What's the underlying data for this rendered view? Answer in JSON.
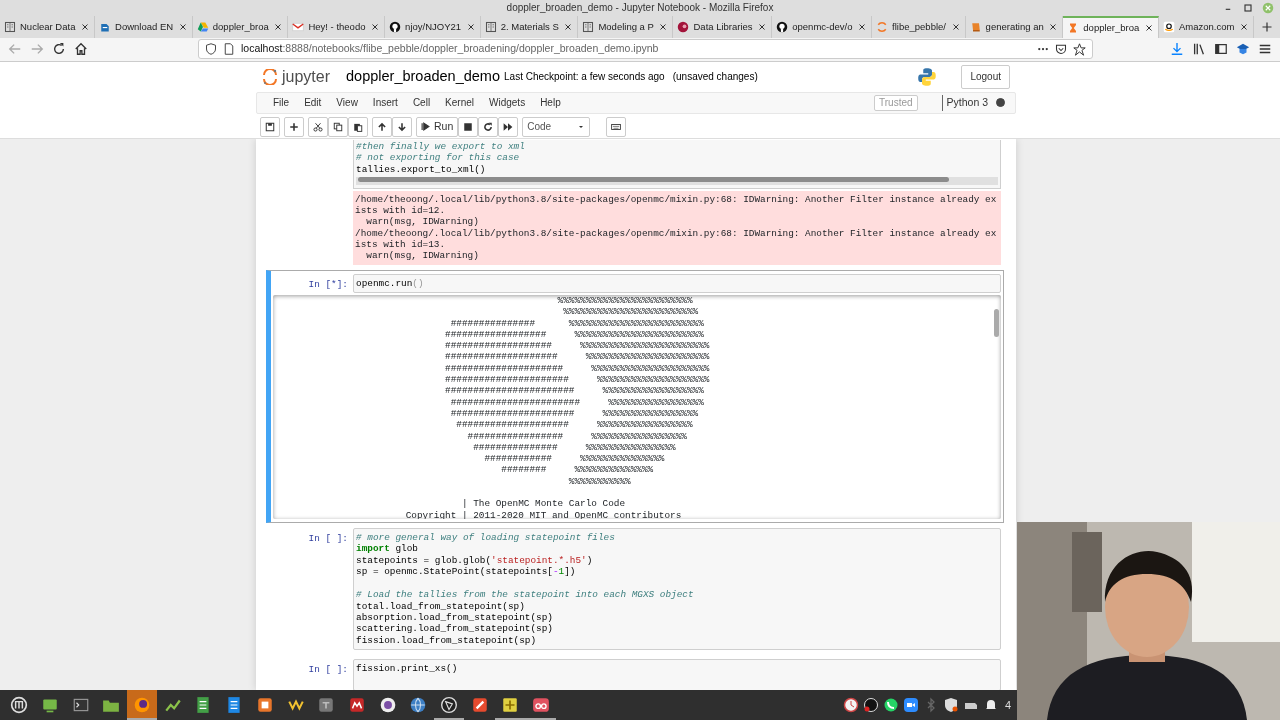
{
  "window": {
    "title": "doppler_broaden_demo - Jupyter Notebook - Mozilla Firefox"
  },
  "tabs": [
    {
      "label": "Nuclear Data",
      "selected": false
    },
    {
      "label": "Download EN",
      "selected": false
    },
    {
      "label": "doppler_broa",
      "selected": false
    },
    {
      "label": "Hey! - theodo",
      "selected": false
    },
    {
      "label": "njoy/NJOY21",
      "selected": false
    },
    {
      "label": "2. Materials S",
      "selected": false
    },
    {
      "label": "Modeling a P",
      "selected": false
    },
    {
      "label": "Data Libraries",
      "selected": false
    },
    {
      "label": "openmc-dev/o",
      "selected": false
    },
    {
      "label": "flibe_pebble/",
      "selected": false
    },
    {
      "label": "generating an",
      "selected": false
    },
    {
      "label": "doppler_broa",
      "selected": true
    },
    {
      "label": "Amazon.com",
      "selected": false
    }
  ],
  "address_bar": {
    "host": "localhost",
    "path": ":8888/notebooks/flibe_pebble/doppler_broadening/doppler_broaden_demo.ipynb"
  },
  "jupyter": {
    "logo_text": "jupyter",
    "notebook_name": "doppler_broaden_demo",
    "checkpoint": "Last Checkpoint: a few seconds ago",
    "unsaved": "(unsaved changes)",
    "logout": "Logout",
    "menu": [
      "File",
      "Edit",
      "View",
      "Insert",
      "Cell",
      "Kernel",
      "Widgets",
      "Help"
    ],
    "trusted": "Trusted",
    "kernel": "Python 3",
    "kernel_busy": true,
    "run_label": "Run",
    "cell_type": "Code"
  },
  "cells": [
    {
      "selected": false,
      "h_scrollbar": true,
      "code": [
        {
          "segments": [
            {
              "kind": "comment",
              "text": "#then finally we export to xml"
            }
          ]
        },
        {
          "segments": [
            {
              "kind": "comment",
              "text": "# not exporting for this case"
            }
          ]
        },
        {
          "segments": [
            {
              "kind": "plain",
              "text": "tallies.export_to_xml()"
            }
          ]
        }
      ],
      "output": {
        "kind": "stderr",
        "lines": [
          "/home/theoong/.local/lib/python3.8/site-packages/openmc/mixin.py:68: IDWarning: Another Filter instance already ex",
          "ists with id=12.",
          "  warn(msg, IDWarning)",
          "/home/theoong/.local/lib/python3.8/site-packages/openmc/mixin.py:68: IDWarning: Another Filter instance already ex",
          "ists with id=13.",
          "  warn(msg, IDWarning)"
        ]
      }
    },
    {
      "prompt": "In [*]:",
      "selected": true,
      "h_scrollbar": false,
      "code": [
        {
          "segments": [
            {
              "kind": "plain",
              "text": "openmc.run"
            },
            {
              "kind": "match",
              "text": "()"
            }
          ]
        }
      ],
      "output": {
        "kind": "scroll",
        "lines": [
          "                                    %%%%%%%%%%%%%%%%%%%%%%%%",
          "                                     %%%%%%%%%%%%%%%%%%%%%%%%",
          "                 ###############      %%%%%%%%%%%%%%%%%%%%%%%%",
          "                ##################     %%%%%%%%%%%%%%%%%%%%%%%",
          "                ###################     %%%%%%%%%%%%%%%%%%%%%%%",
          "                ####################     %%%%%%%%%%%%%%%%%%%%%%",
          "                #####################     %%%%%%%%%%%%%%%%%%%%%",
          "                ######################     %%%%%%%%%%%%%%%%%%%%",
          "                #######################     %%%%%%%%%%%%%%%%%%",
          "                 #######################     %%%%%%%%%%%%%%%%%",
          "                 ######################     %%%%%%%%%%%%%%%%%",
          "                  ####################     %%%%%%%%%%%%%%%%%",
          "                    #################     %%%%%%%%%%%%%%%%%",
          "                     ###############     %%%%%%%%%%%%%%%%",
          "                       ############     %%%%%%%%%%%%%%%",
          "                          ########     %%%%%%%%%%%%%%",
          "                                      %%%%%%%%%%%"
        ],
        "footer_lines": [
          "                   | The OpenMC Monte Carlo Code",
          "         Copyright | 2011-2020 MIT and OpenMC contributors"
        ]
      }
    },
    {
      "prompt": "In [ ]:",
      "selected": false,
      "h_scrollbar": false,
      "code": [
        {
          "segments": [
            {
              "kind": "comment",
              "text": "# more general way of loading statepoint files"
            }
          ]
        },
        {
          "segments": [
            {
              "kind": "keyword",
              "text": "import"
            },
            {
              "kind": "plain",
              "text": " glob"
            }
          ]
        },
        {
          "segments": [
            {
              "kind": "plain",
              "text": "statepoints = glob.glob("
            },
            {
              "kind": "string",
              "text": "'statepoint.*.h5'"
            },
            {
              "kind": "plain",
              "text": ")"
            }
          ]
        },
        {
          "segments": [
            {
              "kind": "plain",
              "text": "sp = openmc.StatePoint(statepoints["
            },
            {
              "kind": "operator",
              "text": "-"
            },
            {
              "kind": "number",
              "text": "1"
            },
            {
              "kind": "plain",
              "text": "])"
            }
          ]
        },
        {
          "space_before": true,
          "segments": [
            {
              "kind": "comment",
              "text": "# Load the tallies from the statepoint into each MGXS object"
            }
          ]
        },
        {
          "segments": [
            {
              "kind": "plain",
              "text": "total.load_from_statepoint(sp)"
            }
          ]
        },
        {
          "segments": [
            {
              "kind": "plain",
              "text": "absorption.load_from_statepoint(sp)"
            }
          ]
        },
        {
          "segments": [
            {
              "kind": "plain",
              "text": "scattering.load_from_statepoint(sp)"
            }
          ]
        },
        {
          "segments": [
            {
              "kind": "plain",
              "text": "fission.load_from_statepoint(sp)"
            }
          ]
        }
      ]
    },
    {
      "prompt": "In [ ]:",
      "selected": false,
      "h_scrollbar": false,
      "code": [
        {
          "segments": [
            {
              "kind": "plain",
              "text": "fission.print_xs()"
            }
          ]
        }
      ]
    }
  ],
  "taskbar": {
    "apps": [
      {
        "selected": false,
        "running": false
      },
      {
        "selected": false,
        "running": false
      },
      {
        "selected": false,
        "running": false
      },
      {
        "selected": false,
        "running": false
      },
      {
        "selected": true,
        "running": true
      },
      {
        "selected": false,
        "running": false
      },
      {
        "selected": false,
        "running": false
      },
      {
        "selected": false,
        "running": false
      },
      {
        "selected": false,
        "running": false
      },
      {
        "selected": false,
        "running": false
      },
      {
        "selected": false,
        "running": false
      },
      {
        "selected": false,
        "running": false
      },
      {
        "selected": false,
        "running": false
      },
      {
        "selected": false,
        "running": false
      },
      {
        "selected": false,
        "running": true
      },
      {
        "selected": false,
        "running": false
      },
      {
        "selected": false,
        "running": true
      },
      {
        "selected": false,
        "running": true
      }
    ],
    "tray_text": "4"
  }
}
